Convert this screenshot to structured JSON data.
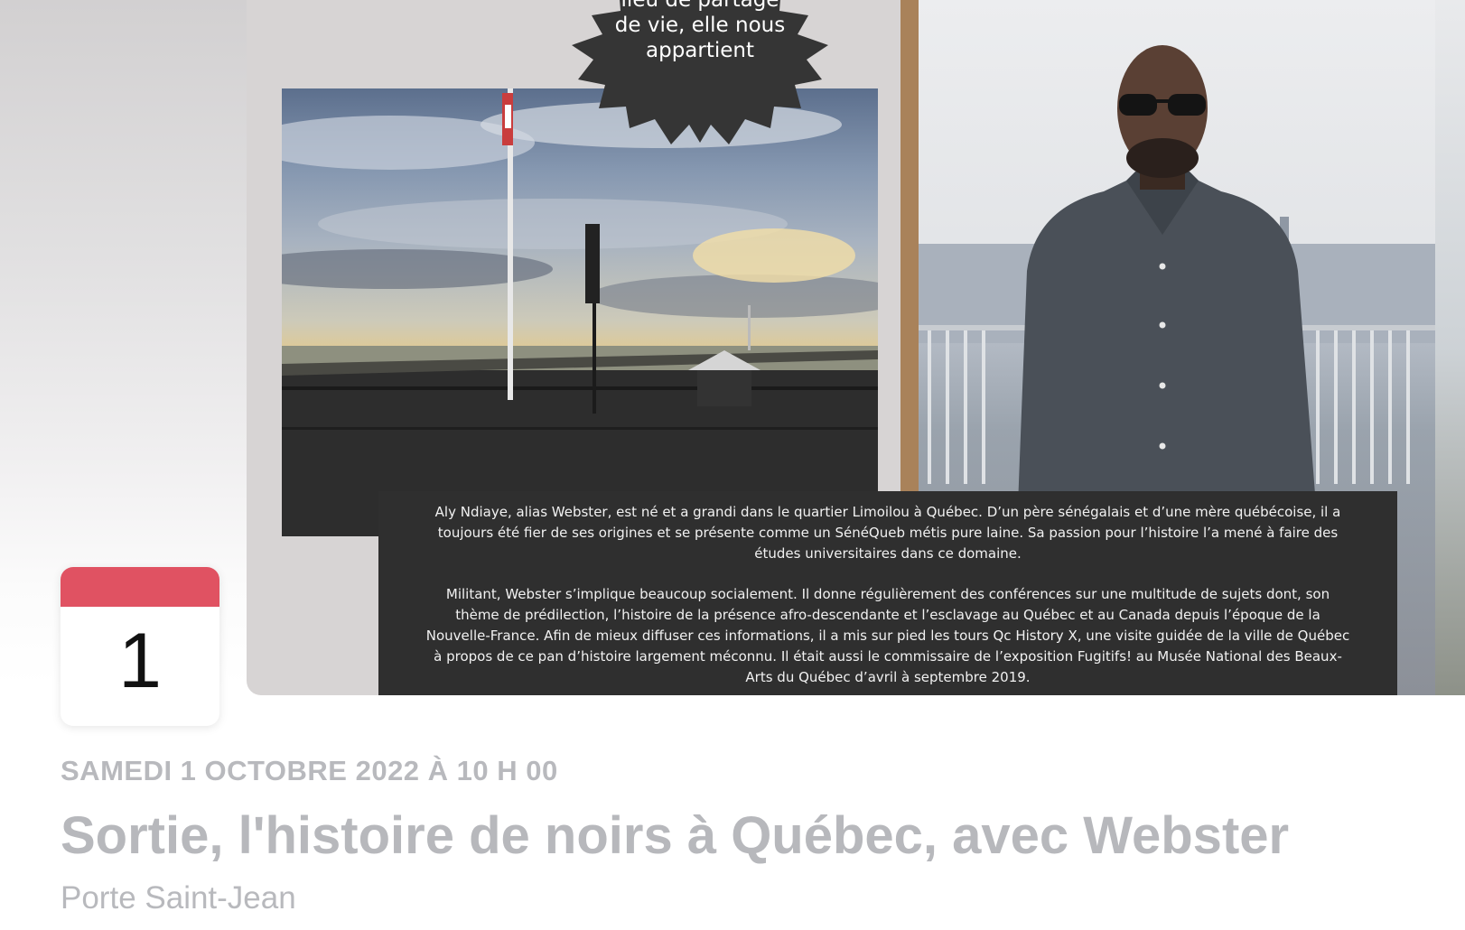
{
  "cover": {
    "quote": {
      "line1": "lieu de partage",
      "line2": "de vie, elle nous",
      "line3": "appartient"
    },
    "bio": {
      "paragraph1": "Aly Ndiaye, alias Webster, est né et a grandi dans le quartier Limoilou à Québec. D’un père sénégalais et d’une mère québécoise, il a toujours été fier de ses origines et se présente comme un SénéQueb métis pure laine. Sa passion pour l’histoire l’a mené à faire des études universitaires dans ce domaine.",
      "paragraph2": "Militant, Webster s’implique beaucoup socialement. Il donne régulièrement des conférences sur une multitude de sujets dont, son thème de prédilection, l’histoire de la présence afro-descendante et l’esclavage au Québec et au Canada depuis l’époque de la Nouvelle-France. Afin de mieux diffuser ces informations, il a mis sur pied les tours Qc History X, une visite guidée de la ville de Québec à propos de ce pan d’histoire largement méconnu. Il était aussi le commissaire de l’exposition Fugitifs! au Musée National des Beaux-Arts du Québec d’avril à septembre 2019."
    }
  },
  "calendar": {
    "day": "1",
    "accent_color": "#e05262"
  },
  "event": {
    "datetime": "SAMEDI 1 OCTOBRE 2022 À 10 H 00",
    "title": "Sortie, l'histoire de noirs à Québec, avec Webster",
    "location": "Porte Saint-Jean"
  }
}
